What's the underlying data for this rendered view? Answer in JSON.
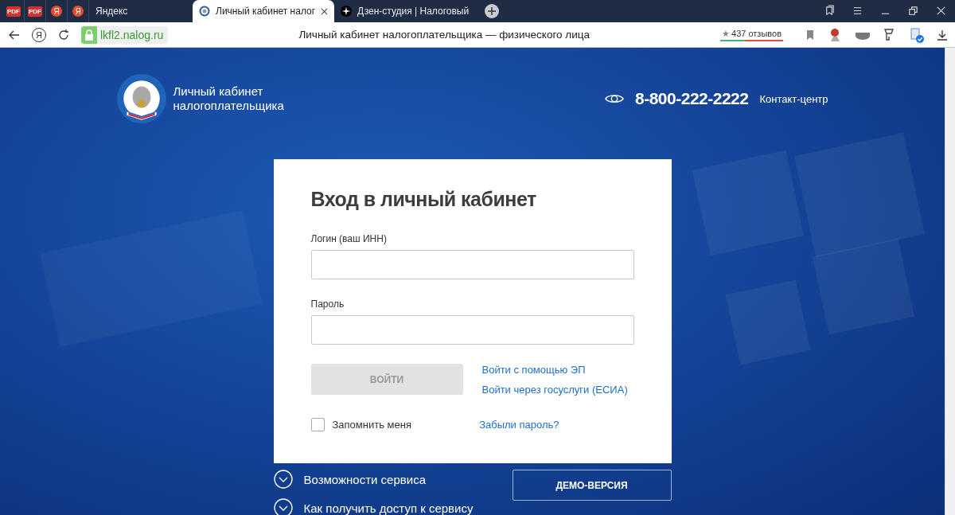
{
  "browser": {
    "pinned_tabs": [
      {
        "kind": "pdf",
        "label": "PDF"
      },
      {
        "kind": "pdf",
        "label": "PDF"
      },
      {
        "kind": "yandex",
        "label": "Я"
      },
      {
        "kind": "yandex",
        "label": "Я"
      }
    ],
    "tabs": [
      {
        "kind": "plain",
        "title": "Яндекс",
        "selected": false
      },
      {
        "kind": "emblem",
        "title": "Личный кабинет налог",
        "selected": true
      },
      {
        "kind": "star",
        "title": "Дзен-студия | Налоговый",
        "selected": false
      }
    ],
    "home_button": "Я",
    "address_bar": {
      "url": "lkfl2.nalog.ru",
      "page_title": "Личный кабинет налогоплательщика — физического лица",
      "reviews_star": "★",
      "reviews": "437 отзывов"
    }
  },
  "header": {
    "logo_text": "Личный кабинет налогоплательщика",
    "phone": "8-800-222-2222",
    "contact": "Контакт-центр"
  },
  "login": {
    "title": "Вход в личный кабинет",
    "fields": [
      {
        "label": "Логин (ваш ИНН)"
      },
      {
        "label": "Пароль"
      }
    ],
    "submit": {
      "label": "ВОЙТИ",
      "disabled": true
    },
    "links": [
      "Войти с помощью ЭП",
      "Войти через госуслуги (ЕСИА)"
    ],
    "remember": {
      "label": "Запомнить меня",
      "checked": false
    },
    "forgot": "Забыли пароль?"
  },
  "sections": [
    {
      "title": "Возможности сервиса",
      "expanded": false
    },
    {
      "title": "Как получить доступ к сервису",
      "expanded": false
    }
  ],
  "demo_button": "ДЕМО-ВЕРСИЯ"
}
